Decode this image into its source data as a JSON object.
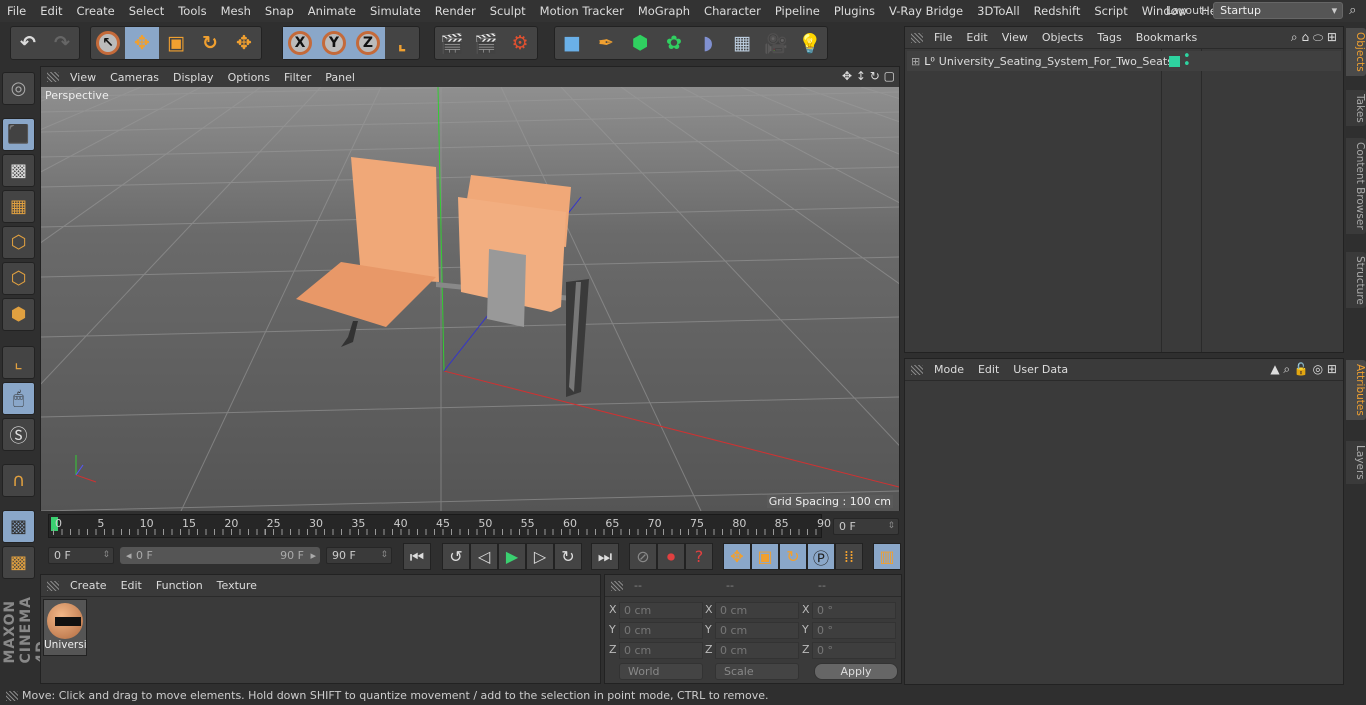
{
  "menu": [
    "File",
    "Edit",
    "Create",
    "Select",
    "Tools",
    "Mesh",
    "Snap",
    "Animate",
    "Simulate",
    "Render",
    "Sculpt",
    "Motion Tracker",
    "MoGraph",
    "Character",
    "Pipeline",
    "Plugins",
    "V-Ray Bridge",
    "3DToAll",
    "Redshift",
    "Script",
    "Window",
    "Help"
  ],
  "layout": {
    "label": "Layout:",
    "value": "Startup"
  },
  "toolbar": {
    "icons": [
      "undo-icon",
      "redo-icon",
      "live-selection-icon",
      "move-icon",
      "scale-icon",
      "rotate-icon",
      "last-tool-icon",
      "x-axis-icon",
      "y-axis-icon",
      "z-axis-icon",
      "coordinate-system-icon",
      "render-view-icon",
      "render-picture-viewer-icon",
      "render-settings-icon",
      "cube-icon",
      "pen-icon",
      "subdivision-icon",
      "cloner-icon",
      "deformer-icon",
      "floor-icon",
      "camera-icon",
      "light-icon"
    ],
    "axis_labels": [
      "X",
      "Y",
      "Z"
    ]
  },
  "left_toolbar": [
    "make-editable-icon",
    "model-mode-icon",
    "texture-mode-icon",
    "workplane-icon",
    "points-mode-icon",
    "edges-mode-icon",
    "polygons-mode-icon",
    "axis-mode-icon",
    "tweak-mode-icon",
    "snap-s-icon",
    "magnet-icon",
    "lock-workplane-icon",
    "workplane-rotate-icon"
  ],
  "viewport": {
    "menu": [
      "View",
      "Cameras",
      "Display",
      "Options",
      "Filter",
      "Panel"
    ],
    "camera": "Perspective",
    "grid_spacing": "Grid Spacing : 100 cm"
  },
  "timeline": {
    "ticks": [
      "0",
      "5",
      "10",
      "15",
      "20",
      "25",
      "30",
      "35",
      "40",
      "45",
      "50",
      "55",
      "60",
      "65",
      "70",
      "75",
      "80",
      "85",
      "90"
    ],
    "current": "0 F",
    "current_frame": 0,
    "max": 90
  },
  "transport": {
    "start": "0 F",
    "range_start": "0 F",
    "range_end": "90 F",
    "end": "90 F"
  },
  "materials": {
    "menu": [
      "Create",
      "Edit",
      "Function",
      "Texture"
    ],
    "items": [
      {
        "name": "Universi"
      }
    ]
  },
  "coords": {
    "headers": [
      "--",
      "--",
      "--"
    ],
    "rows": [
      {
        "axis": "X",
        "pos": "0 cm",
        "size": "0 cm",
        "rot": "0 °"
      },
      {
        "axis": "Y",
        "pos": "0 cm",
        "size": "0 cm",
        "rot": "0 °"
      },
      {
        "axis": "Z",
        "pos": "0 cm",
        "size": "0 cm",
        "rot": "0 °"
      }
    ],
    "world": "World",
    "scale": "Scale",
    "apply": "Apply"
  },
  "objects": {
    "menu": [
      "File",
      "Edit",
      "View",
      "Objects",
      "Tags",
      "Bookmarks"
    ],
    "items": [
      {
        "name": "University_Seating_System_For_Two_Seats",
        "color": "#2ed3a0"
      }
    ]
  },
  "attributes": {
    "menu": [
      "Mode",
      "Edit",
      "User Data"
    ]
  },
  "side_tabs": [
    "Objects",
    "Takes",
    "Content Browser",
    "Structure"
  ],
  "side_tabs2": [
    "Attributes",
    "Layers"
  ],
  "logo": "MAXON CINEMA 4D",
  "status": "Move: Click and drag to move elements. Hold down SHIFT to quantize movement / add to the selection in point mode, CTRL to remove."
}
